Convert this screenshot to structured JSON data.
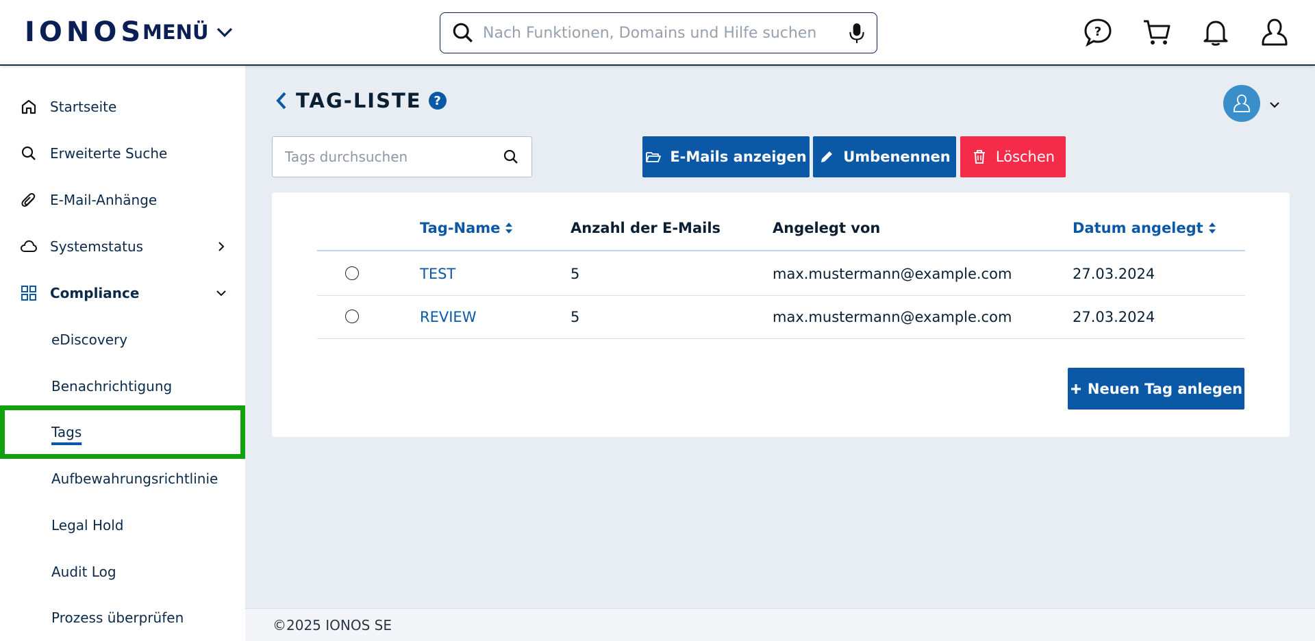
{
  "header": {
    "logo": "IONOS",
    "menu_label": "MENÜ",
    "search_placeholder": "Nach Funktionen, Domains und Hilfe suchen",
    "icons": [
      "help-chat-icon",
      "cart-icon",
      "bell-icon",
      "user-icon"
    ]
  },
  "sidebar": {
    "items": [
      {
        "label": "Startseite",
        "icon": "home-icon"
      },
      {
        "label": "Erweiterte Suche",
        "icon": "search-icon"
      },
      {
        "label": "E-Mail-Anhänge",
        "icon": "paperclip-icon"
      },
      {
        "label": "Systemstatus",
        "icon": "cloud-icon"
      },
      {
        "label": "Compliance",
        "icon": "grid-icon"
      }
    ],
    "subitems": [
      {
        "label": "eDiscovery"
      },
      {
        "label": "Benachrichtigung"
      },
      {
        "label": "Tags"
      },
      {
        "label": "Aufbewahrungsrichtlinie"
      },
      {
        "label": "Legal Hold"
      },
      {
        "label": "Audit Log"
      },
      {
        "label": "Prozess überprüfen"
      }
    ],
    "active": "Tags"
  },
  "main": {
    "title": "TAG-LISTE",
    "help": "?",
    "tag_search_placeholder": "Tags durchsuchen",
    "buttons": {
      "show_emails": "E-Mails anzeigen",
      "rename": "Umbenennen",
      "delete": "Löschen",
      "new_tag": "Neuen Tag anlegen"
    },
    "table": {
      "columns": [
        "Tag-Name",
        "Anzahl der E-Mails",
        "Angelegt von",
        "Datum angelegt"
      ],
      "rows": [
        {
          "name": "TEST",
          "count": "5",
          "created_by": "max.mustermann@example.com",
          "date": "27.03.2024"
        },
        {
          "name": "REVIEW",
          "count": "5",
          "created_by": "max.mustermann@example.com",
          "date": "27.03.2024"
        }
      ]
    }
  },
  "footer": {
    "copyright": "©2025 IONOS SE"
  },
  "colors": {
    "brand_dark": "#0b1f55",
    "primary_blue": "#0b58a6",
    "danger_red": "#f52b4a",
    "highlight_green": "#11a00e",
    "background": "#e8ecf3"
  }
}
